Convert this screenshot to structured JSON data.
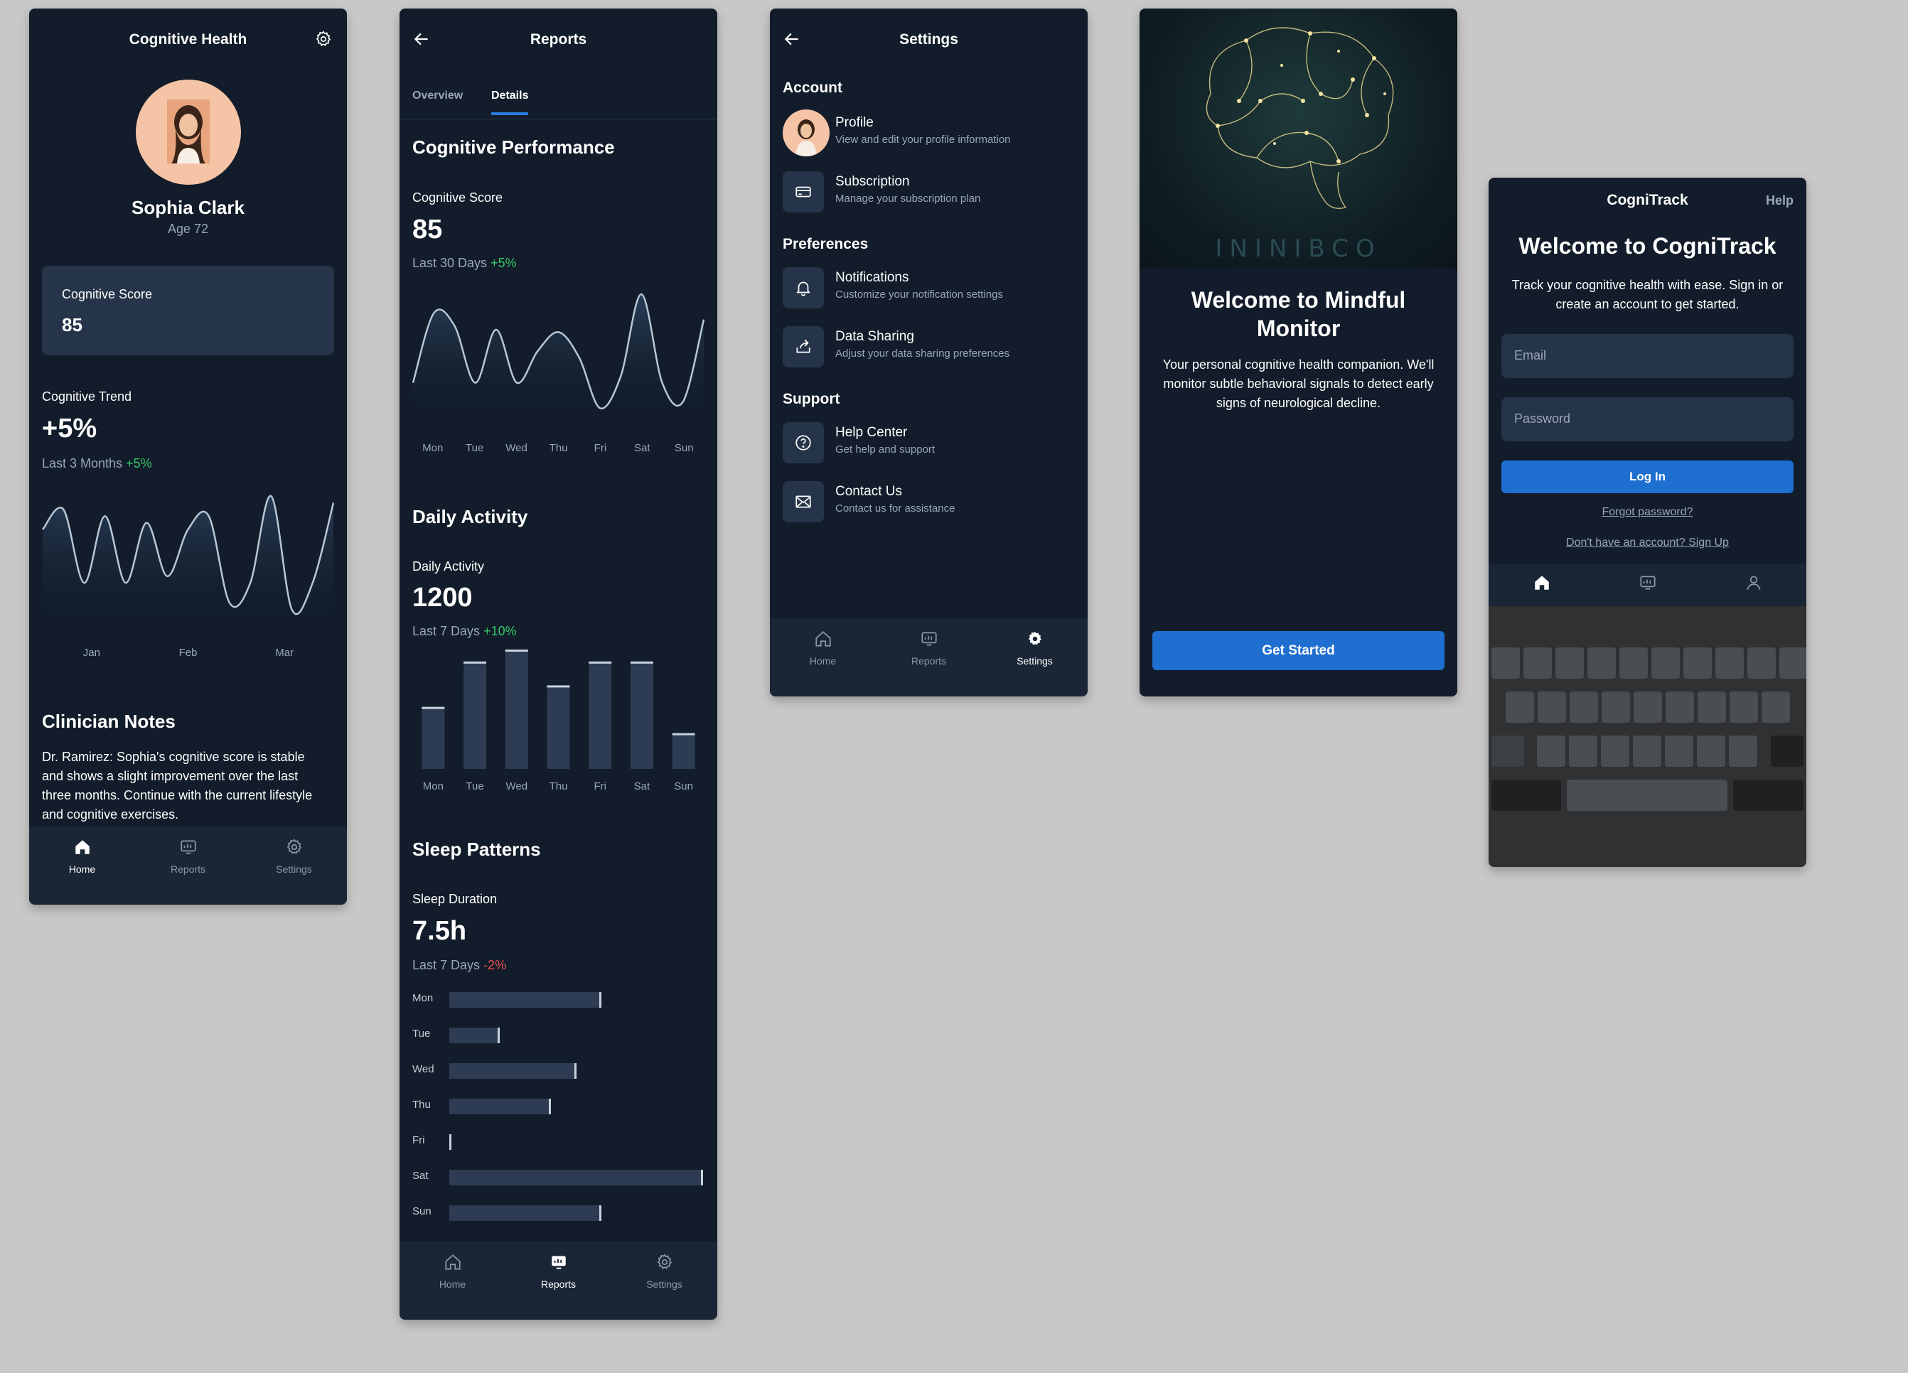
{
  "home": {
    "title": "Cognitive Health",
    "name": "Sophia Clark",
    "age": "Age 72",
    "score_label": "Cognitive Score",
    "score_value": "85",
    "trend_label": "Cognitive Trend",
    "trend_value": "+5%",
    "trend_sub": "Last 3 Months",
    "trend_delta": "+5%",
    "trend_months": [
      "Jan",
      "Feb",
      "Mar"
    ],
    "notes_title": "Clinician Notes",
    "notes_text": "Dr. Ramirez: Sophia's cognitive score is stable and shows a slight improvement over the last three months. Continue with the current lifestyle and cognitive exercises."
  },
  "reports": {
    "title": "Reports",
    "tabs": [
      "Overview",
      "Details"
    ],
    "perf_title": "Cognitive Performance",
    "score_label": "Cognitive Score",
    "score_value": "85",
    "score_sub": "Last 30 Days",
    "score_delta": "+5%",
    "activity_title": "Daily Activity",
    "activity_label": "Daily Activity",
    "activity_value": "1200",
    "activity_sub": "Last 7 Days",
    "activity_delta": "+10%",
    "sleep_title": "Sleep Patterns",
    "sleep_label": "Sleep Duration",
    "sleep_value": "7.5h",
    "sleep_sub": "Last 7 Days",
    "sleep_delta": "-2%"
  },
  "chart_data": [
    {
      "type": "line",
      "x": [
        "Jan",
        "Feb",
        "Mar"
      ],
      "values": [
        0.75,
        0.9,
        0.35,
        0.85,
        0.35,
        0.8,
        0.4,
        0.75,
        0.85,
        0.2,
        0.35,
        1.0,
        0.15,
        0.35,
        0.95
      ],
      "title": "Cognitive Trend"
    },
    {
      "type": "line",
      "x": [
        "Mon",
        "Tue",
        "Wed",
        "Thu",
        "Fri",
        "Sat",
        "Sun"
      ],
      "values": [
        0.3,
        0.85,
        0.75,
        0.3,
        0.72,
        0.3,
        0.55,
        0.7,
        0.5,
        0.1,
        0.35,
        1.0,
        0.3,
        0.15,
        0.8
      ],
      "title": "Cognitive Score"
    },
    {
      "type": "bar",
      "categories": [
        "Mon",
        "Tue",
        "Wed",
        "Thu",
        "Fri",
        "Sat",
        "Sun"
      ],
      "values": [
        0.52,
        0.9,
        1.0,
        0.7,
        0.9,
        0.9,
        0.3
      ],
      "title": "Daily Activity"
    },
    {
      "type": "bar",
      "orientation": "horizontal",
      "categories": [
        "Mon",
        "Tue",
        "Wed",
        "Thu",
        "Fri",
        "Sat",
        "Sun"
      ],
      "values": [
        0.6,
        0.2,
        0.5,
        0.4,
        0.0,
        1.0,
        0.6
      ],
      "title": "Sleep Duration"
    }
  ],
  "settings": {
    "title": "Settings",
    "groups": [
      "Account",
      "Preferences",
      "Support"
    ],
    "items": [
      {
        "title": "Profile",
        "desc": "View and edit your profile information"
      },
      {
        "title": "Subscription",
        "desc": "Manage your subscription plan"
      },
      {
        "title": "Notifications",
        "desc": "Customize your notification settings"
      },
      {
        "title": "Data Sharing",
        "desc": "Adjust your data sharing preferences"
      },
      {
        "title": "Help Center",
        "desc": "Get help and support"
      },
      {
        "title": "Contact Us",
        "desc": "Contact us for assistance"
      }
    ]
  },
  "onboarding": {
    "brand": "ININIBCO",
    "title": "Welcome to Mindful Monitor",
    "text": "Your personal cognitive health companion. We'll monitor subtle behavioral signals to detect early signs of neurological decline.",
    "cta": "Get Started"
  },
  "login": {
    "app_name": "CogniTrack",
    "help": "Help",
    "title": "Welcome to CogniTrack",
    "text": "Track your cognitive health with ease. Sign in or create an account to get started.",
    "email_placeholder": "Email",
    "password_placeholder": "Password",
    "login_button": "Log In",
    "forgot": "Forgot password?",
    "signup": "Don't have an account? Sign Up"
  },
  "nav": {
    "home": "Home",
    "reports": "Reports",
    "settings": "Settings"
  },
  "colors": {
    "background": "#c8c8c8",
    "screen": "#121c2a",
    "card": "#253448",
    "accent": "#1f6fd0",
    "positive": "#35c86a",
    "negative": "#ef5350"
  }
}
